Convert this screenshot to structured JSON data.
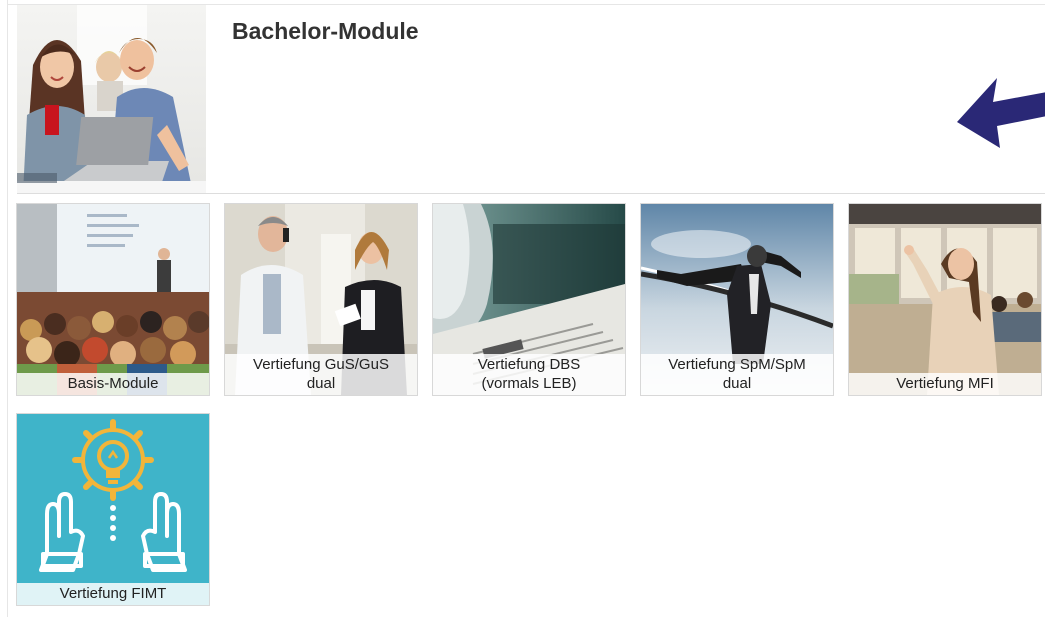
{
  "header": {
    "title": "Bachelor-Module",
    "image_icon": "students-laptop-photo"
  },
  "arrow": {
    "icon": "arrow-pointer-icon",
    "color": "#2a2876"
  },
  "tiles": [
    {
      "label": "Basis-Module",
      "icon": "lecture-hall-photo"
    },
    {
      "label": "Vertiefung GuS/GuS\ndual",
      "icon": "doctor-phone-photo"
    },
    {
      "label": "Vertiefung DBS\n(vormals LEB)",
      "icon": "document-scanner-photo"
    },
    {
      "label": "Vertiefung SpM/SpM\ndual",
      "icon": "finish-line-photo"
    },
    {
      "label": "Vertiefung MFI",
      "icon": "whiteboard-teacher-photo"
    },
    {
      "label": "Vertiefung FIMT",
      "icon": "lightbulb-hands-icon"
    }
  ],
  "colors": {
    "fimt_background": "#3fb4c9",
    "fimt_accent": "#f2b53a",
    "title": "#333333"
  }
}
